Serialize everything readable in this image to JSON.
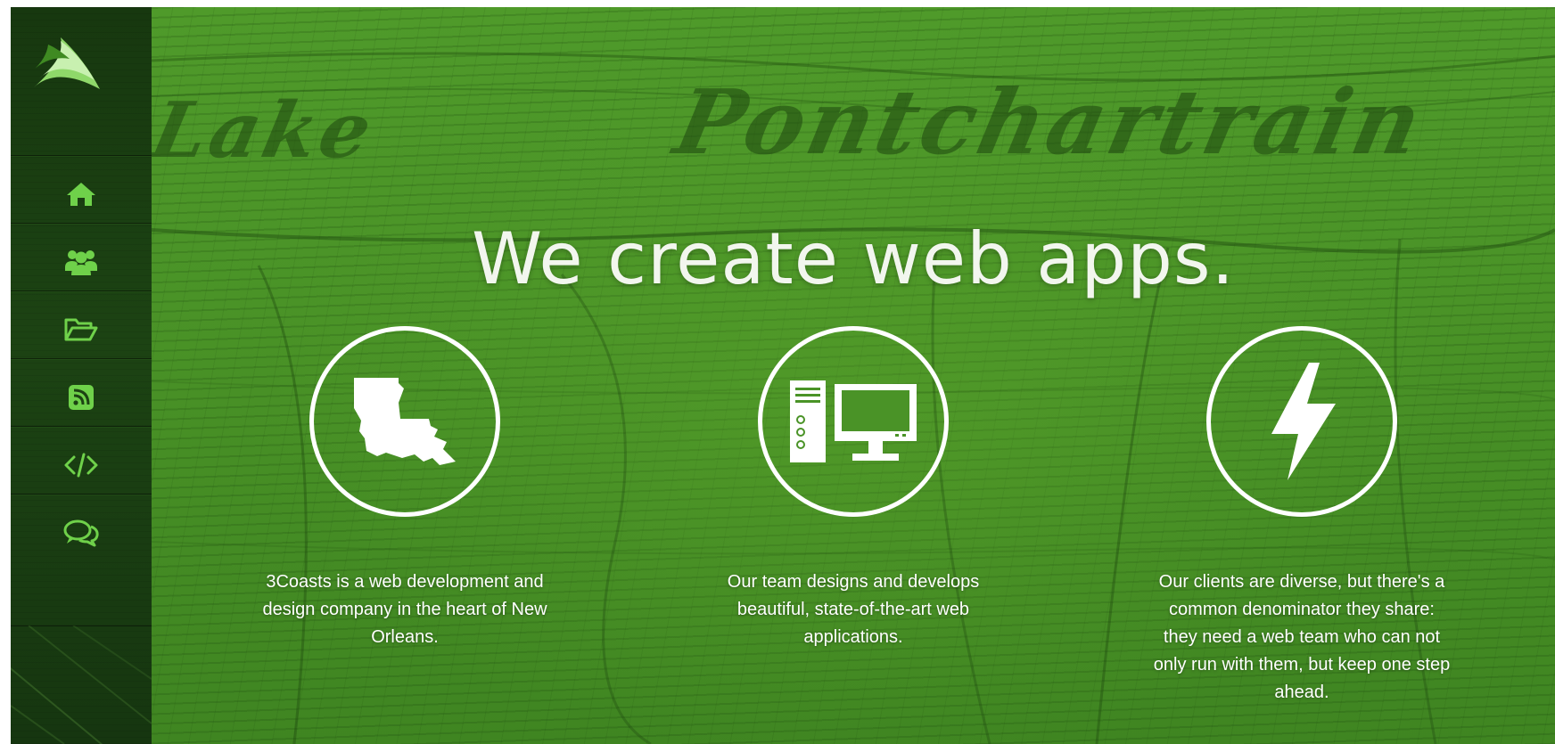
{
  "sidebar": {
    "logo_icon": "3coasts-leaf-logo",
    "items": [
      {
        "icon": "home-icon"
      },
      {
        "icon": "users-icon"
      },
      {
        "icon": "folder-open-icon"
      },
      {
        "icon": "rss-icon"
      },
      {
        "icon": "code-icon"
      },
      {
        "icon": "chat-bubbles-icon"
      }
    ]
  },
  "hero": {
    "map_words": [
      "Lake",
      "Pontchartrain"
    ],
    "headline": "We create web apps.",
    "features": [
      {
        "icon": "louisiana-state-icon",
        "text": "3Coasts is a web development and design company in the heart of New Orleans."
      },
      {
        "icon": "desktop-computer-icon",
        "text": "Our team designs and develops beautiful, state-of-the-art web applications."
      },
      {
        "icon": "lightning-bolt-icon",
        "text": "Our clients are diverse, but there's a common denominator they share: they need a web team who can not only run with them, but keep one step ahead."
      }
    ]
  },
  "colors": {
    "hero_green": "#4a9327",
    "sidebar_dark": "#1c4313",
    "icon_green": "#6fd14a",
    "text_white": "#ffffff"
  }
}
